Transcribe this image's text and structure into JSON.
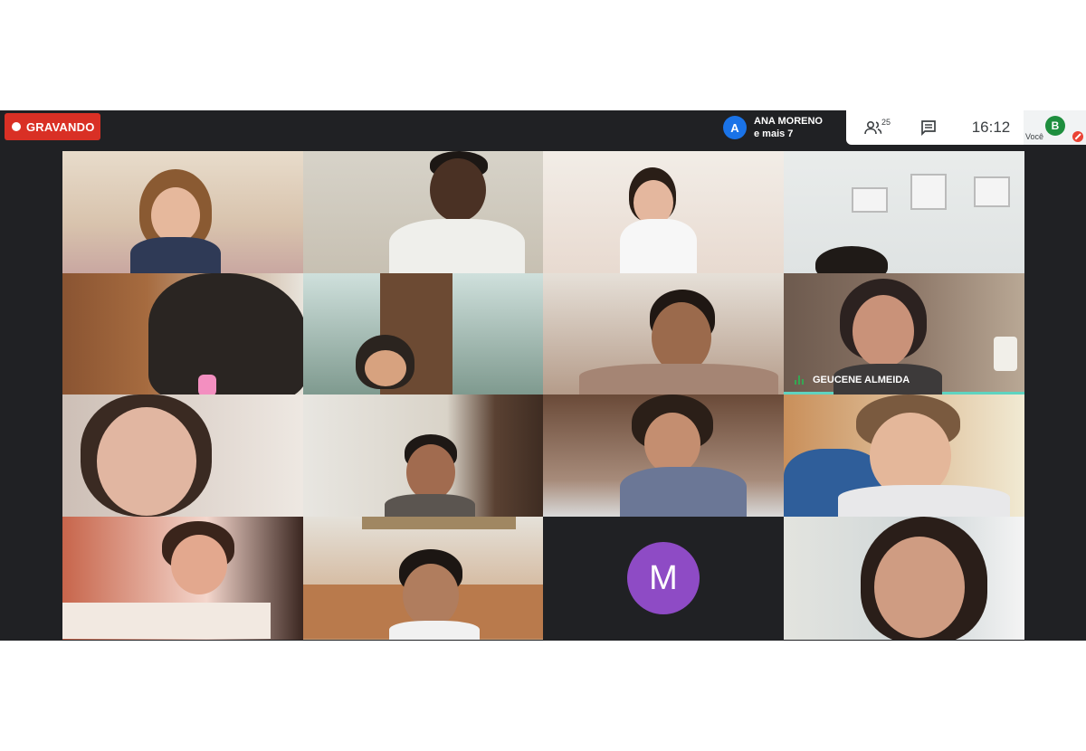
{
  "recording": {
    "label": "GRAVANDO"
  },
  "presenter": {
    "avatar_letter": "A",
    "name": "ANA MORENO",
    "others": "e mais 7"
  },
  "toolbar": {
    "people_count": "25",
    "clock": "16:12",
    "self_avatar": "B",
    "self_label": "Você"
  },
  "colors": {
    "recording": "#d93025",
    "presenter_avatar": "#1a73e8",
    "self_avatar": "#1e8e3e",
    "m_avatar": "#8e4bc5",
    "active_speaker": "#5fd3c0"
  },
  "tiles": [
    {
      "type": "video"
    },
    {
      "type": "video"
    },
    {
      "type": "video"
    },
    {
      "type": "video"
    },
    {
      "type": "video"
    },
    {
      "type": "video"
    },
    {
      "type": "video"
    },
    {
      "type": "video",
      "name": "GEUCENE ALMEIDA",
      "speaking": true
    },
    {
      "type": "video"
    },
    {
      "type": "video"
    },
    {
      "type": "video"
    },
    {
      "type": "video"
    },
    {
      "type": "video"
    },
    {
      "type": "video"
    },
    {
      "type": "avatar",
      "letter": "M"
    },
    {
      "type": "video"
    }
  ]
}
